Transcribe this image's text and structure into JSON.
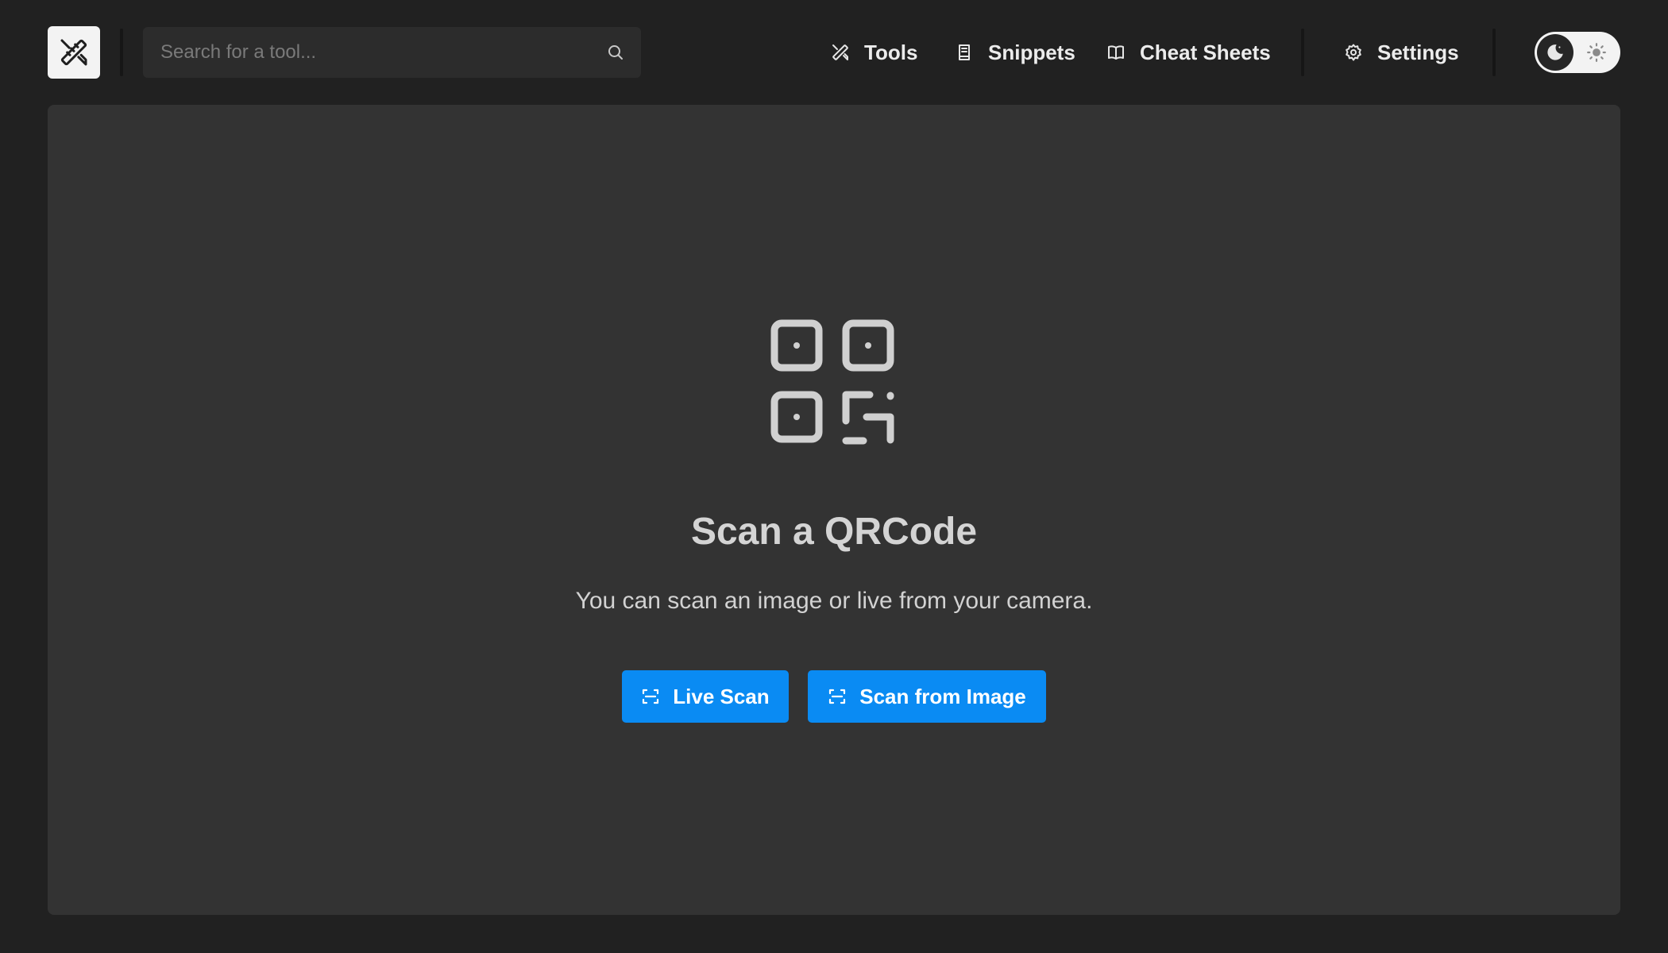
{
  "header": {
    "logo_icon": "tools-logo-icon",
    "search": {
      "placeholder": "Search for a tool...",
      "value": "",
      "icon": "search-icon"
    },
    "nav": [
      {
        "label": "Tools",
        "icon": "tools-icon"
      },
      {
        "label": "Snippets",
        "icon": "book-icon"
      },
      {
        "label": "Cheat Sheets",
        "icon": "open-book-icon"
      },
      {
        "label": "Settings",
        "icon": "gear-icon"
      }
    ],
    "theme_toggle": {
      "active": "dark",
      "dark_icon": "moon-icon",
      "light_icon": "sun-icon"
    }
  },
  "main": {
    "icon": "qrcode-icon",
    "title": "Scan a QRCode",
    "subtitle": "You can scan an image or live from your camera.",
    "buttons": [
      {
        "label": "Live Scan",
        "icon": "scan-icon"
      },
      {
        "label": "Scan from Image",
        "icon": "scan-icon"
      }
    ]
  },
  "colors": {
    "background": "#212121",
    "panel": "#333333",
    "accent": "#0a8bf3",
    "text": "#d4d4d4"
  }
}
